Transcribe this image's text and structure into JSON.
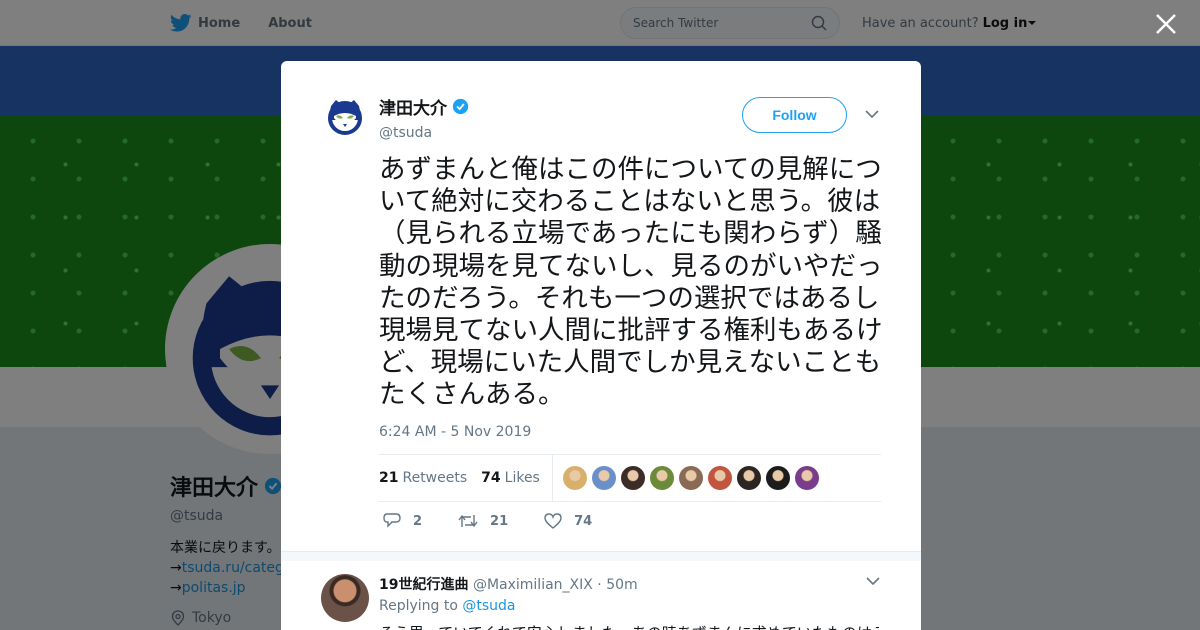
{
  "nav": {
    "home_label": "Home",
    "about_label": "About",
    "search_placeholder": "Search Twitter",
    "have_account": "Have an account?",
    "login_label": "Log in"
  },
  "profile": {
    "name": "津田大介",
    "handle": "@tsuda",
    "bio": "本業に戻ります。",
    "link1": "tsuda.ru/catego",
    "link2": "politas.jp",
    "location": "Tokyo"
  },
  "tweet": {
    "author_name": "津田大介",
    "author_handle": "@tsuda",
    "follow_label": "Follow",
    "text": "あずまんと俺はこの件についての見解について絶対に交わることはないと思う。彼は（見られる立場であったにも関わらず）騒動の現場を見てないし、見るのがいやだったのだろう。それも一つの選択ではあるし現場見てない人間に批評する権利もあるけど、現場にいた人間でしか見えないこともたくさんある。",
    "timestamp": "6:24 AM - 5 Nov 2019",
    "retweets_count": "21",
    "retweets_label": "Retweets",
    "likes_count": "74",
    "likes_label": "Likes",
    "liker_colors": [
      "#d9b06b",
      "#6b8fc9",
      "#3b2c28",
      "#6b8a3a",
      "#8a6a55",
      "#c2553f",
      "#2b2622",
      "#1c1c1c",
      "#7a3d8c"
    ],
    "reply_count": "2",
    "retweet_action_count": "21",
    "like_action_count": "74"
  },
  "reply": {
    "name": "19世紀行進曲",
    "handle": "@Maximilian_XIX",
    "dot": "·",
    "time": "50m",
    "replying_to_label": "Replying to",
    "replying_to_handle": "@tsuda",
    "text": "そう思っていてくれて安心しました。あの時あずまんに求めていたものはそう"
  },
  "colors": {
    "accent": "#1da1f2",
    "verified": "#1da1f2",
    "napster_blue": "#1a3a8f",
    "napster_green": "#7cb342"
  }
}
